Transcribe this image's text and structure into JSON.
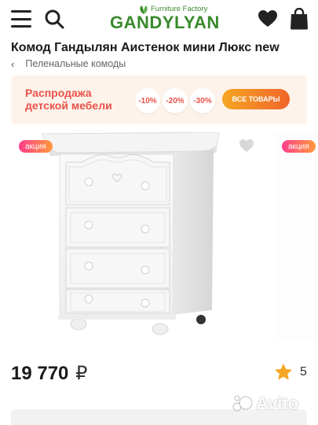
{
  "header": {
    "logo_small": "Furniture Factory",
    "logo_main": "GANDYLYAN",
    "icons": [
      "menu-icon",
      "search-icon",
      "heart-icon",
      "shopping-bag-icon"
    ]
  },
  "product": {
    "title": "Комод Гандылян Аистенок мини Люкс new",
    "breadcrumb": "Пеленальные комоды",
    "price": "19 770",
    "currency": "₽",
    "rating": "5"
  },
  "banner": {
    "line1": "Распродажа",
    "line2": "детской мебели",
    "discounts": [
      "-10%",
      "-20%",
      "-30%"
    ],
    "button": "ВСЕ ТОВАРЫ"
  },
  "gallery": {
    "badge": "акция",
    "badge_next": "акция"
  },
  "watermark": "Avito",
  "colors": {
    "brand_green": "#3a8a2c",
    "banner_red": "#e8524a",
    "star": "#f5a623"
  }
}
